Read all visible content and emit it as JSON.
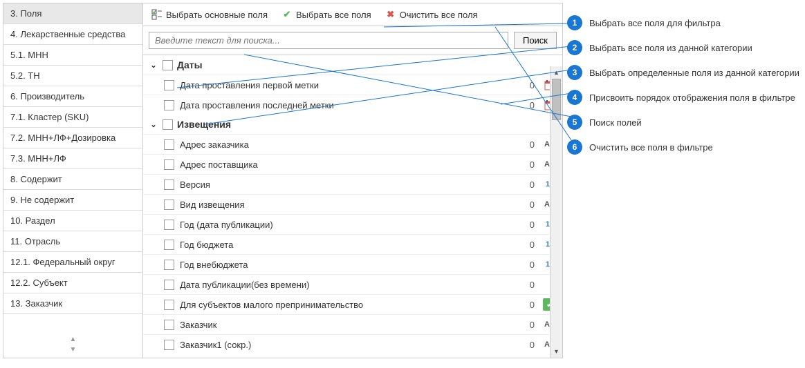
{
  "sidebar": {
    "items": [
      {
        "label": "3. Поля"
      },
      {
        "label": "4. Лекарственные средства"
      },
      {
        "label": "5.1. МНН"
      },
      {
        "label": "5.2. ТН"
      },
      {
        "label": "6. Производитель"
      },
      {
        "label": "7.1. Кластер (SKU)"
      },
      {
        "label": "7.2. МНН+ЛФ+Дозировка"
      },
      {
        "label": "7.3. МНН+ЛФ"
      },
      {
        "label": "8. Содержит"
      },
      {
        "label": "9. Не содержит"
      },
      {
        "label": "10. Раздел"
      },
      {
        "label": "11. Отрасль"
      },
      {
        "label": "12.1. Федеральный округ"
      },
      {
        "label": "12.2. Субъект"
      },
      {
        "label": "13. Заказчик"
      }
    ]
  },
  "toolbar": {
    "select_main": "Выбрать основные поля",
    "select_all": "Выбрать все поля",
    "clear_all": "Очистить все поля"
  },
  "search": {
    "placeholder": "Введите текст для поиска...",
    "button": "Поиск"
  },
  "groups": [
    {
      "name": "Даты",
      "rows": [
        {
          "label": "Дата проставления первой метки",
          "order": "0",
          "type": "date"
        },
        {
          "label": "Дата проставления последней метки",
          "order": "0",
          "type": "date"
        }
      ]
    },
    {
      "name": "Извещения",
      "rows": [
        {
          "label": "Адрес заказчика",
          "order": "0",
          "type": "text"
        },
        {
          "label": "Адрес поставщика",
          "order": "0",
          "type": "text"
        },
        {
          "label": "Версия",
          "order": "0",
          "type": "num"
        },
        {
          "label": "Вид извещения",
          "order": "0",
          "type": "text"
        },
        {
          "label": "Год (дата публикации)",
          "order": "0",
          "type": "num"
        },
        {
          "label": "Год бюджета",
          "order": "0",
          "type": "num"
        },
        {
          "label": "Год внебюджета",
          "order": "0",
          "type": "num"
        },
        {
          "label": "Дата публикации(без времени)",
          "order": "0",
          "type": ""
        },
        {
          "label": "Для субъектов малого препринимательство",
          "order": "0",
          "type": "bool"
        },
        {
          "label": "Заказчик",
          "order": "0",
          "type": "text"
        },
        {
          "label": "Заказчик1 (сокр.)",
          "order": "0",
          "type": "text"
        }
      ]
    }
  ],
  "annotations": [
    {
      "n": "1",
      "text": "Выбрать все поля для фильтра"
    },
    {
      "n": "2",
      "text": "Выбрать все поля из данной категории"
    },
    {
      "n": "3",
      "text": "Выбрать определенные поля из данной категории"
    },
    {
      "n": "4",
      "text": "Присвоить порядок отображения поля в фильтре"
    },
    {
      "n": "5",
      "text": "Поиск полей"
    },
    {
      "n": "6",
      "text": "Очистить все поля в фильтре"
    }
  ]
}
